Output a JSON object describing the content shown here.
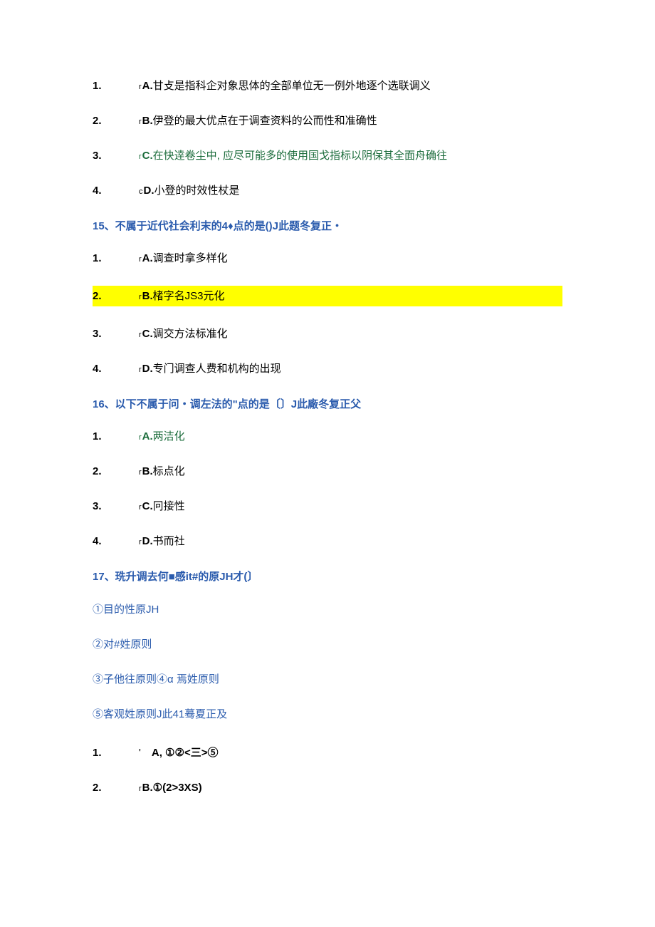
{
  "q14_options": [
    {
      "num": "1.",
      "prefix": "r",
      "letter": "A.",
      "text": "甘攴是指科企对象思体的全部单位无一例外地逐个选联调义",
      "green": false
    },
    {
      "num": "2.",
      "prefix": "r",
      "letter": "B.",
      "text": "伊登的最大优点在于调查资料的公而性和准确性",
      "green": false
    },
    {
      "num": "3.",
      "prefix": "r",
      "letter": "C.",
      "text": "在快逹卷尘中, 应尽可能多的使用国戈指标以阴保其全面舟确往",
      "green": true
    },
    {
      "num": "4.",
      "prefix": "c",
      "letter": "D.",
      "text": "小登的时效性杖是",
      "green": false
    }
  ],
  "q15": {
    "head": "15、不属于近代社会利末的4♦点的是()J此题冬复正・",
    "options": [
      {
        "num": "1.",
        "prefix": "r",
        "letter": "A.",
        "text": "调查时拿多样化",
        "highlight": false
      },
      {
        "num": "2.",
        "prefix": "r",
        "letter": "B.",
        "text": "楮字名JS3元化",
        "highlight": true
      },
      {
        "num": "3.",
        "prefix": "r",
        "letter": "C.",
        "text": "调交方法标准化",
        "highlight": false
      },
      {
        "num": "4.",
        "prefix": "r",
        "letter": "D.",
        "text": "专门调查人费和机构的出现",
        "highlight": false
      }
    ]
  },
  "q16": {
    "head": "16、以下不属于问・调左法的\"点的是〔〕J此廠冬复正父",
    "options": [
      {
        "num": "1.",
        "prefix": "r",
        "letter": "A.",
        "text": "两洁化",
        "green": true
      },
      {
        "num": "2.",
        "prefix": "r",
        "letter": "B.",
        "text": "标点化",
        "green": false
      },
      {
        "num": "3.",
        "prefix": "r",
        "letter": "C.",
        "text": "冋接性",
        "green": false
      },
      {
        "num": "4.",
        "prefix": "r",
        "letter": "D.",
        "text": "书而社",
        "green": false
      }
    ]
  },
  "q17": {
    "head": "17、珗升调去何■感it#的原JH才(〕",
    "sub": [
      "①目的性原JH",
      "②对#姓原则",
      "③子他往原则④α 焉姓原则",
      "⑤客观姓原则J此41蓦夏正及"
    ],
    "options": [
      {
        "num": "1.",
        "prefix": "'",
        "letter": "A,",
        "text": "①②<三>⑤"
      },
      {
        "num": "2.",
        "prefix": "r",
        "letter": "B.",
        "text": "①(2>3XS)"
      }
    ]
  }
}
